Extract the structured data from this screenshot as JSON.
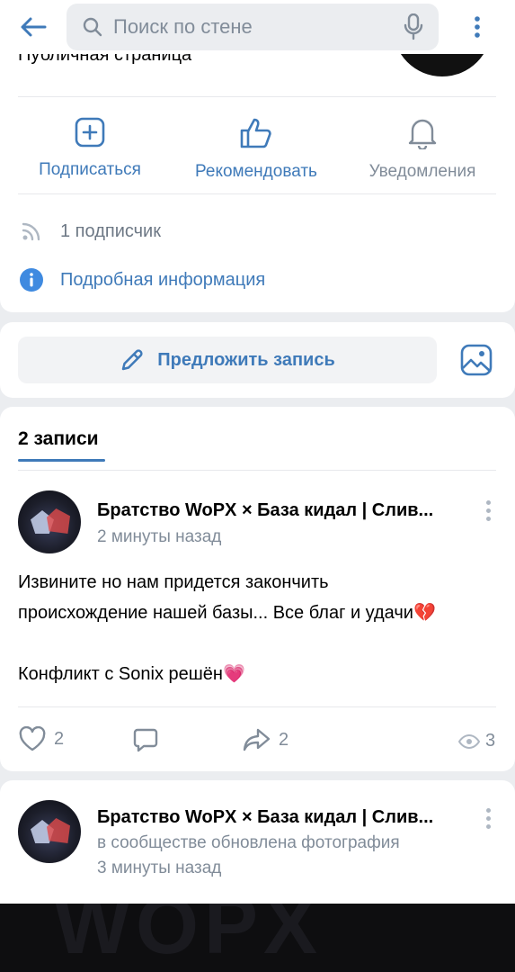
{
  "topbar": {
    "search_placeholder": "Поиск по стене",
    "icons": [
      "arrow-left-icon",
      "search-icon",
      "microphone-icon",
      "more-vertical-icon"
    ]
  },
  "header": {
    "partial_title": "Публичная страница",
    "actions": [
      {
        "label": "Подписаться",
        "icon": "add-square-icon"
      },
      {
        "label": "Рекомендовать",
        "icon": "thumb-up-icon"
      },
      {
        "label": "Уведомления",
        "icon": "bell-icon"
      }
    ],
    "subscribers": "1 подписчик",
    "details_link": "Подробная информация"
  },
  "suggest": {
    "label": "Предложить запись"
  },
  "wall": {
    "tab_label": "2 записи",
    "posts": [
      {
        "author": "Братство WoPX × База кидал | Слив...",
        "time": "2 минуты назад",
        "text_line1": "Извините но нам придется закончить",
        "text_line2": "происхождение нашей базы... Все благ и удачи",
        "emoji1": "💔",
        "text_line3": "Конфликт с Sonix решён",
        "emoji2": "💗",
        "likes": "2",
        "shares": "2",
        "views": "3"
      },
      {
        "author": "Братство WoPX × База кидал | Слив...",
        "event": "в сообществе обновлена фотография",
        "time": "3 минуты назад"
      }
    ]
  },
  "colors": {
    "accent": "#3f7ab9",
    "secondary": "#818c99",
    "background": "#ebedf0"
  }
}
